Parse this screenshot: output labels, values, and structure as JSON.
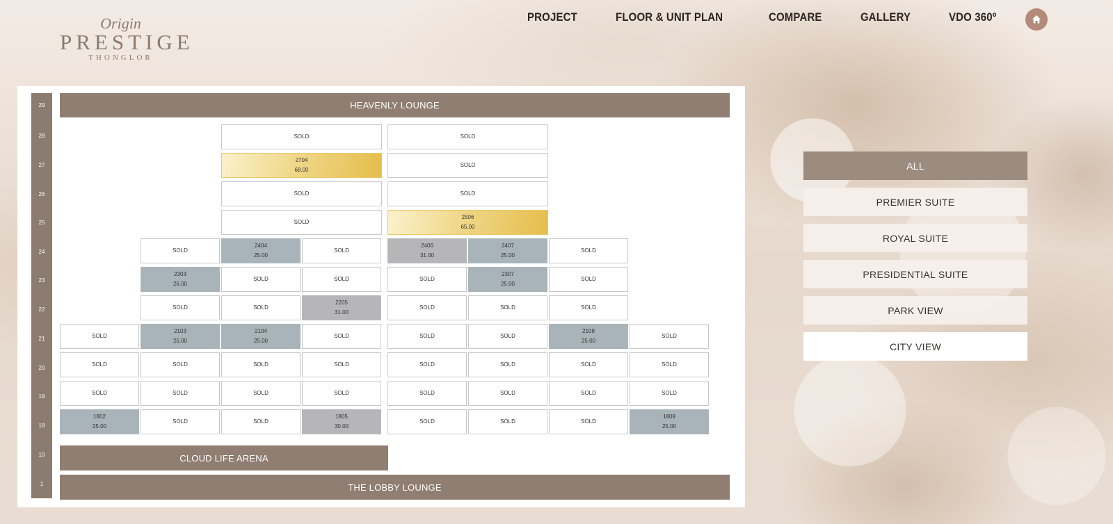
{
  "logo": {
    "line1": "Origin",
    "line2": "PRESTIGE",
    "line3": "THONGLOR"
  },
  "nav": {
    "items": [
      "PROJECT",
      "FLOOR & UNIT PLAN",
      "COMPARE",
      "GALLERY",
      "VDO 360º"
    ],
    "home_icon": "home-icon"
  },
  "floors": [
    "29",
    "28",
    "27",
    "26",
    "25",
    "24",
    "23",
    "22",
    "21",
    "20",
    "19",
    "18",
    "10",
    "1"
  ],
  "bands": {
    "heavenly": "HEAVENLY LOUNGE",
    "cloud": "CLOUD LIFE ARENA",
    "lobby": "THE LOBBY LOUNGE"
  },
  "sold_label": "SOLD",
  "floor_rows": {
    "f28": [
      {
        "status": "SOLD"
      },
      {
        "status": "SOLD"
      }
    ],
    "f27": [
      {
        "no": "2704",
        "size": "68.00",
        "type": "gold"
      },
      {
        "status": "SOLD"
      }
    ],
    "f26": [
      {
        "status": "SOLD"
      },
      {
        "status": "SOLD"
      }
    ],
    "f25": [
      {
        "status": "SOLD"
      },
      {
        "no": "2506",
        "size": "65.00",
        "type": "gold"
      }
    ],
    "f24": [
      {
        "status": "SOLD"
      },
      {
        "no": "2404",
        "size": "25.00",
        "type": "blue"
      },
      {
        "status": "SOLD"
      },
      {
        "no": "2406",
        "size": "31.00",
        "type": "gray"
      },
      {
        "no": "2407",
        "size": "25.00",
        "type": "blue"
      },
      {
        "status": "SOLD"
      }
    ],
    "f23": [
      {
        "no": "2303",
        "size": "26.00",
        "type": "blue"
      },
      {
        "status": "SOLD"
      },
      {
        "status": "SOLD"
      },
      {
        "status": "SOLD"
      },
      {
        "no": "2307",
        "size": "25.00",
        "type": "blue"
      },
      {
        "status": "SOLD"
      }
    ],
    "f22": [
      {
        "status": "SOLD"
      },
      {
        "status": "SOLD"
      },
      {
        "no": "2205",
        "size": "31.00",
        "type": "gray"
      },
      {
        "status": "SOLD"
      },
      {
        "status": "SOLD"
      },
      {
        "status": "SOLD"
      }
    ],
    "f21": [
      {
        "status": "SOLD"
      },
      {
        "no": "2103",
        "size": "25.00",
        "type": "blue"
      },
      {
        "no": "2104",
        "size": "25.00",
        "type": "blue"
      },
      {
        "status": "SOLD"
      },
      {
        "status": "SOLD"
      },
      {
        "status": "SOLD"
      },
      {
        "no": "2108",
        "size": "25.00",
        "type": "blue"
      },
      {
        "status": "SOLD"
      }
    ],
    "f20": [
      {
        "status": "SOLD"
      },
      {
        "status": "SOLD"
      },
      {
        "status": "SOLD"
      },
      {
        "status": "SOLD"
      },
      {
        "status": "SOLD"
      },
      {
        "status": "SOLD"
      },
      {
        "status": "SOLD"
      },
      {
        "status": "SOLD"
      }
    ],
    "f19": [
      {
        "status": "SOLD"
      },
      {
        "status": "SOLD"
      },
      {
        "status": "SOLD"
      },
      {
        "status": "SOLD"
      },
      {
        "status": "SOLD"
      },
      {
        "status": "SOLD"
      },
      {
        "status": "SOLD"
      },
      {
        "status": "SOLD"
      }
    ],
    "f18": [
      {
        "no": "1802",
        "size": "25.00",
        "type": "blue"
      },
      {
        "status": "SOLD"
      },
      {
        "status": "SOLD"
      },
      {
        "no": "1805",
        "size": "30.00",
        "type": "gray"
      },
      {
        "status": "SOLD"
      },
      {
        "status": "SOLD"
      },
      {
        "status": "SOLD"
      },
      {
        "no": "1809",
        "size": "25.00",
        "type": "blue"
      }
    ]
  },
  "filters": [
    "ALL",
    "PREMIER SUITE",
    "ROYAL SUITE",
    "PRESIDENTIAL SUITE",
    "PARK VIEW",
    "CITY VIEW"
  ],
  "colors": {
    "available_blue": "#a9b4ba",
    "available_gray": "#b6b6b8",
    "premium_gold": "#e5bd4c",
    "band_brown": "#8f7e71",
    "active_filter": "#9c8c80"
  }
}
